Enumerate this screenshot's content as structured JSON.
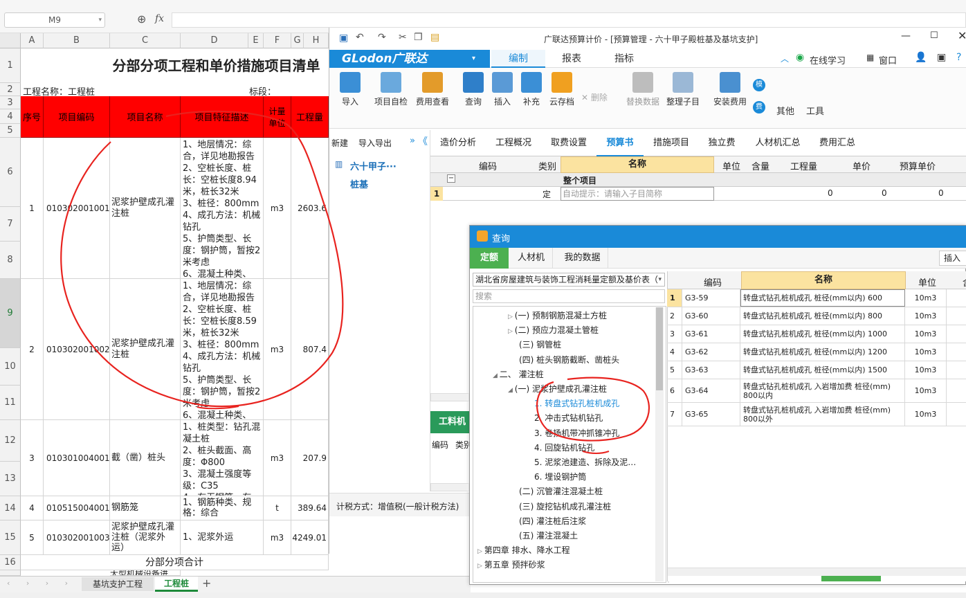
{
  "excel": {
    "namebox": "M9",
    "fx": "fx",
    "columns": [
      "A",
      "B",
      "C",
      "D",
      "E",
      "F",
      "G",
      "H"
    ],
    "rows": [
      "1",
      "2",
      "3",
      "4",
      "5",
      "6",
      "7",
      "8",
      "9",
      "10",
      "11",
      "12",
      "13",
      "14",
      "15",
      "16"
    ],
    "title": "分部分项工程和单价措施项目清单",
    "project_label": "工程名称：工程桩",
    "section_label": "标段：",
    "headers": {
      "seq": "序号",
      "code": "项目编码",
      "name": "项目名称",
      "feature": "项目特征描述",
      "unit": "计量单位",
      "qty": "工程量"
    },
    "items": [
      {
        "seq": "1",
        "code": "010302001001",
        "name": "泥浆护壁成孔灌注桩",
        "feature": "1、地层情况：综合，详见地勘报告\n2、空桩长度、桩长：空桩长度8.94米，桩长32米\n3、桩径：800mm\n4、成孔方法：机械钻孔\n5、护筒类型、长度：钢护筒，暂按2米考虑\n6、混凝土种类、",
        "unit": "m3",
        "qty": "2603.6"
      },
      {
        "seq": "2",
        "code": "010302001002",
        "name": "泥浆护壁成孔灌注桩",
        "feature": "1、地层情况：综合，详见地勘报告\n2、空桩长度、桩长：空桩长度8.59米，桩长32米\n3、桩径：800mm\n4、成孔方法：机械钻孔\n5、护筒类型、长度：钢护筒，暂按2米考虑\n6、混凝土种类、",
        "unit": "m3",
        "qty": "807.4"
      },
      {
        "seq": "3",
        "code": "010301004001",
        "name": "截（凿）桩头",
        "feature": "1、桩类型：钻孔混凝土桩\n2、桩头截面、高度：Φ800\n3、混凝土强度等级：C35\n4、有无钢筋、有",
        "unit": "m3",
        "qty": "207.9"
      },
      {
        "seq": "4",
        "code": "010515004001",
        "name": "钢筋笼",
        "feature": "1、钢筋种类、规格：综合",
        "unit": "t",
        "qty": "389.64"
      },
      {
        "seq": "5",
        "code": "010302001003",
        "name": "泥浆护壁成孔灌注桩（泥浆外运）",
        "feature": "1、泥浆外运",
        "unit": "m3",
        "qty": "4249.01"
      }
    ],
    "subtotal": "分部分项合计",
    "row17_partial": "大型机械设备进",
    "sheets": [
      "基坑支护工程",
      "工程桩"
    ],
    "add_sheet": "+"
  },
  "glodon": {
    "window_title": "广联达预算计价 - [预算管理 - 六十甲子殿桩基及基坑支护]",
    "logo": "GLodon广联达",
    "ribbon_tabs": [
      "编制",
      "报表",
      "指标"
    ],
    "online_learning": "在线学习",
    "window_menu": "窗口",
    "toolbar": [
      "导入",
      "项目自检",
      "费用查看",
      "查询",
      "插入",
      "补充",
      "云存档",
      "删除",
      "替换数据",
      "整理子目",
      "安装费用",
      "其他",
      "工具"
    ],
    "side_icons": [
      "模",
      "费"
    ],
    "left_toolbar": [
      "新建",
      "导入导出"
    ],
    "tree": [
      "六十甲子···",
      "桩基"
    ],
    "main_tabs": [
      "造价分析",
      "工程概况",
      "取费设置",
      "预算书",
      "措施项目",
      "独立费",
      "人材机汇总",
      "费用汇总"
    ],
    "grid_headers": [
      "编码",
      "类别",
      "名称",
      "单位",
      "含量",
      "工程量",
      "单价",
      "预算单价"
    ],
    "grid_group": "整个项目",
    "grid_row": {
      "num": "1",
      "type": "定",
      "hint": "自动提示：请输入子目简称",
      "qty": "0",
      "price": "0",
      "budget": "0"
    },
    "bottom_tab": "工料机显",
    "bottom_cols": [
      "编码",
      "类别"
    ],
    "tax_mode": "计税方式：增值税(一般计税方法)"
  },
  "query": {
    "title": "查询",
    "tabs": [
      "定额",
      "人材机",
      "我的数据"
    ],
    "insert_btn": "插入",
    "dropdown": "湖北省房屋建筑与装饰工程消耗量定额及基价表（",
    "search_placeholder": "搜索",
    "tree": [
      {
        "text": "(一) 预制钢筋混凝土方桩",
        "indent": 3,
        "arrow": "▷"
      },
      {
        "text": "(二) 预应力混凝土管桩",
        "indent": 3,
        "arrow": "▷"
      },
      {
        "text": "(三) 钢管桩",
        "indent": 3,
        "arrow": ""
      },
      {
        "text": "(四) 桩头钢筋截断、凿桩头",
        "indent": 3,
        "arrow": ""
      },
      {
        "text": "二、 灌注桩",
        "indent": 2,
        "arrow": "◢"
      },
      {
        "text": "(一) 泥浆护壁成孔灌注桩",
        "indent": 3,
        "arrow": "◢"
      },
      {
        "text": "1. 转盘式钻孔桩机成孔",
        "indent": 4,
        "arrow": "",
        "selected": true
      },
      {
        "text": "2. 冲击式钻机钻孔",
        "indent": 4,
        "arrow": ""
      },
      {
        "text": "3. 卷扬机带冲抓锥冲孔",
        "indent": 4,
        "arrow": ""
      },
      {
        "text": "4. 回旋钻机钻孔",
        "indent": 4,
        "arrow": ""
      },
      {
        "text": "5. 泥浆池建造、拆除及泥…",
        "indent": 4,
        "arrow": ""
      },
      {
        "text": "6. 埋设钢护筒",
        "indent": 4,
        "arrow": ""
      },
      {
        "text": "(二) 沉管灌注混凝土桩",
        "indent": 3,
        "arrow": ""
      },
      {
        "text": "(三) 旋挖钻机成孔灌注桩",
        "indent": 3,
        "arrow": ""
      },
      {
        "text": "(四) 灌注桩后注浆",
        "indent": 3,
        "arrow": ""
      },
      {
        "text": "(五) 灌注混凝土",
        "indent": 3,
        "arrow": ""
      },
      {
        "text": "第四章 排水、降水工程",
        "indent": 1,
        "arrow": "▷"
      },
      {
        "text": "第五章 预拌砂浆",
        "indent": 1,
        "arrow": "▷"
      }
    ],
    "grid_headers": [
      "编码",
      "名称",
      "单位",
      "含"
    ],
    "rows": [
      {
        "n": "1",
        "code": "G3-59",
        "name": "转盘式钻孔桩机成孔 桩径(mm以内) 600",
        "unit": "10m3"
      },
      {
        "n": "2",
        "code": "G3-60",
        "name": "转盘式钻孔桩机成孔 桩径(mm以内) 800",
        "unit": "10m3"
      },
      {
        "n": "3",
        "code": "G3-61",
        "name": "转盘式钻孔桩机成孔 桩径(mm以内) 1000",
        "unit": "10m3"
      },
      {
        "n": "4",
        "code": "G3-62",
        "name": "转盘式钻孔桩机成孔 桩径(mm以内) 1200",
        "unit": "10m3"
      },
      {
        "n": "5",
        "code": "G3-63",
        "name": "转盘式钻孔桩机成孔 桩径(mm以内) 1500",
        "unit": "10m3"
      },
      {
        "n": "6",
        "code": "G3-64",
        "name": "转盘式钻孔桩机成孔 入岩增加费 桩径(mm) 800以内",
        "unit": "10m3"
      },
      {
        "n": "7",
        "code": "G3-65",
        "name": "转盘式钻孔桩机成孔 入岩增加费 桩径(mm) 800以外",
        "unit": "10m3"
      }
    ]
  },
  "colors": {
    "accent_blue": "#1a8ad8",
    "header_red": "#ff0000",
    "green": "#4cb050",
    "annotation_red": "#e8231f"
  }
}
